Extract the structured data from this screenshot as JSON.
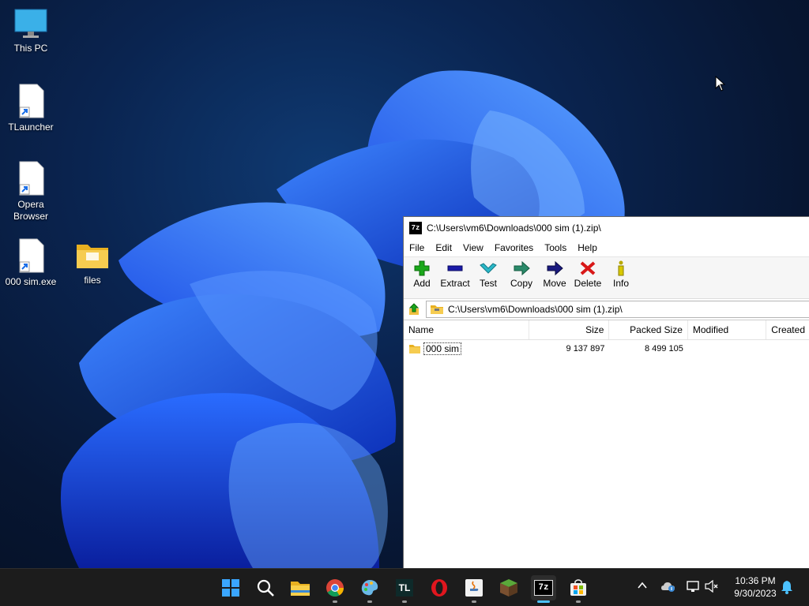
{
  "desktop": {
    "icons": [
      {
        "label": "This PC",
        "icon": "monitor-icon"
      },
      {
        "label": "TLauncher",
        "icon": "file-shortcut-icon"
      },
      {
        "label": "Opera Browser",
        "icon": "file-shortcut-icon"
      },
      {
        "label": "000 sim.exe",
        "icon": "file-shortcut-icon"
      },
      {
        "label": "files",
        "icon": "folder-icon"
      }
    ]
  },
  "window": {
    "title": "C:\\Users\\vm6\\Downloads\\000 sim (1).zip\\",
    "app_icon_label": "7z",
    "menu": [
      "File",
      "Edit",
      "View",
      "Favorites",
      "Tools",
      "Help"
    ],
    "toolbar": [
      "Add",
      "Extract",
      "Test",
      "Copy",
      "Move",
      "Delete",
      "Info"
    ],
    "address": "C:\\Users\\vm6\\Downloads\\000 sim (1).zip\\",
    "columns": [
      "Name",
      "Size",
      "Packed Size",
      "Modified",
      "Created"
    ],
    "rows": [
      {
        "name": "000 sim",
        "size": "9 137 897",
        "packed": "8 499 105",
        "modified": "",
        "created": ""
      }
    ]
  },
  "taskbar": {
    "apps": [
      "start-icon",
      "search-icon",
      "file-explorer-icon",
      "chrome-icon",
      "paint-icon",
      "tlauncher-icon",
      "opera-icon",
      "java-icon",
      "minecraft-icon",
      "7zip-icon",
      "store-icon"
    ],
    "tlauncher_label": "TL",
    "sevenzip_label": "7z",
    "time": "10:36 PM",
    "date": "9/30/2023"
  },
  "colors": {
    "add": "#1aa81a",
    "extract": "#1a1aa8",
    "test": "#2bb8c8",
    "copy": "#2a8a6a",
    "move": "#1a1a80",
    "delete": "#d81818",
    "info": "#b8a800",
    "folder": "#f0c040"
  }
}
